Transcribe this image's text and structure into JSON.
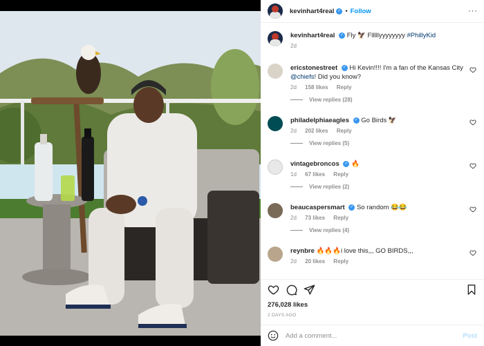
{
  "header": {
    "username": "kevinhart4real",
    "follow_label": "Follow",
    "more_glyph": "···"
  },
  "caption": {
    "username": "kevinhart4real",
    "text": "Fly 🦅 Flllllyyyyyyyy ",
    "hashtag": "#PhillyKid",
    "time": "2d"
  },
  "comments": [
    {
      "username": "ericstonestreet",
      "verified": true,
      "text_before": "Hi Kevin!!!! I'm a fan of the Kansas City ",
      "mention": "@chiefs",
      "text_after": "! Did you know?",
      "time": "2d",
      "likes": "158 likes",
      "reply": "Reply",
      "view_replies": "View replies (28)",
      "avatar_color": "#d9d3c8"
    },
    {
      "username": "philadelphiaeagles",
      "verified": true,
      "text": "Go Birds 🦅",
      "time": "2d",
      "likes": "202 likes",
      "reply": "Reply",
      "view_replies": "View replies (5)",
      "avatar_color": "#004c54"
    },
    {
      "username": "vintagebroncos",
      "verified": true,
      "text": "🔥",
      "time": "1d",
      "likes": "67 likes",
      "reply": "Reply",
      "view_replies": "View replies (2)",
      "avatar_color": "#e8e8e8"
    },
    {
      "username": "beaucaspersmart",
      "verified": true,
      "text": "So random 😂😂",
      "time": "2d",
      "likes": "73 likes",
      "reply": "Reply",
      "view_replies": "View replies (4)",
      "avatar_color": "#7a6a58"
    },
    {
      "username": "reynbre",
      "verified": false,
      "text": "🔥🔥🔥i love this,,, GO BIRDS,,,",
      "time": "2d",
      "likes": "20 likes",
      "reply": "Reply",
      "avatar_color": "#b8a58c"
    }
  ],
  "footer": {
    "likes": "276,028 likes",
    "ago": "2 DAYS AGO",
    "comment_placeholder": "Add a comment...",
    "post_label": "Post"
  },
  "colors": {
    "accent": "#0095f6",
    "verified": "#3897f0",
    "muted": "#8e8e8e"
  },
  "icons": [
    "heart-icon",
    "comment-icon",
    "share-icon",
    "save-icon",
    "emoji-icon",
    "verified-icon"
  ]
}
